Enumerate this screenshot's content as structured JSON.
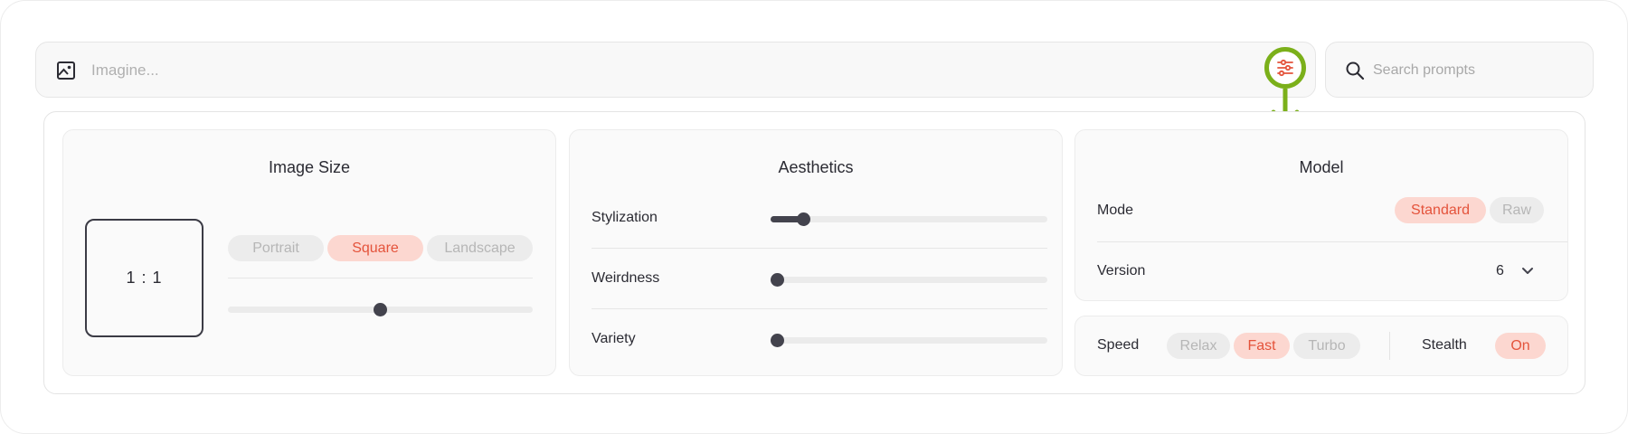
{
  "prompt": {
    "placeholder": "Imagine...",
    "image_icon": "image-icon",
    "settings_icon": "sliders-icon"
  },
  "search": {
    "placeholder": "Search prompts",
    "icon": "search-icon"
  },
  "image_size": {
    "title": "Image Size",
    "ratio": "1 : 1",
    "options": [
      "Portrait",
      "Square",
      "Landscape"
    ],
    "selected": "Square",
    "slider_value": 0.5
  },
  "aesthetics": {
    "title": "Aesthetics",
    "rows": [
      {
        "label": "Stylization",
        "value": 0.12
      },
      {
        "label": "Weirdness",
        "value": 0.0
      },
      {
        "label": "Variety",
        "value": 0.0
      }
    ]
  },
  "model": {
    "title": "Model",
    "mode_label": "Mode",
    "mode_options": [
      "Standard",
      "Raw"
    ],
    "mode_selected": "Standard",
    "version_label": "Version",
    "version_value": "6"
  },
  "speed": {
    "label": "Speed",
    "options": [
      "Relax",
      "Fast",
      "Turbo"
    ],
    "selected": "Fast",
    "stealth_label": "Stealth",
    "stealth_value": "On"
  },
  "colors": {
    "accent": "#e4533b",
    "accent_bg": "#fcd7d0",
    "highlight_ring": "#7bb01a",
    "slider": "#43434d"
  }
}
